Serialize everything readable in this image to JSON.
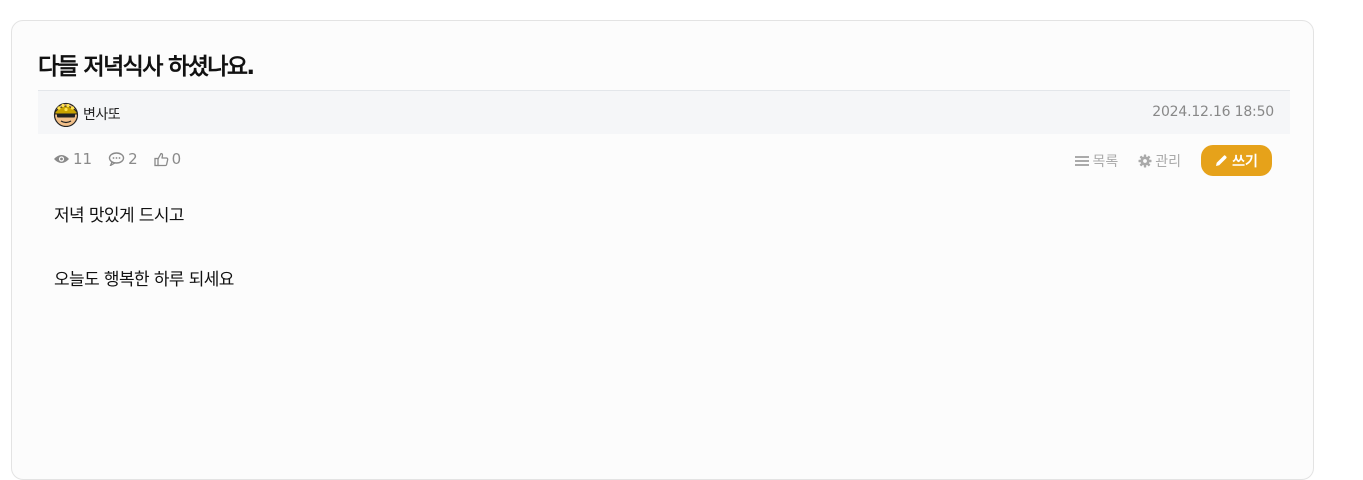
{
  "post": {
    "title": "다들 저녁식사 하셨나요.",
    "author": "변사또",
    "date": "2024.12.16 18:50",
    "stats": {
      "views": "11",
      "comments": "2",
      "likes": "0"
    },
    "content": [
      "저녁 맛있게 드시고",
      "오늘도 행복한 하루 되세요"
    ]
  },
  "actions": {
    "list_label": "목록",
    "manage_label": "관리",
    "write_label": "쓰기"
  },
  "icons": {
    "views": "eye-icon",
    "comments": "comment-icon",
    "likes": "thumbs-up-icon",
    "list": "list-icon",
    "manage": "gear-icon",
    "write": "pencil-icon"
  },
  "colors": {
    "accent": "#e6a21a",
    "meta_bar_bg": "#f5f6f8",
    "muted_text": "#8a8a8a"
  }
}
